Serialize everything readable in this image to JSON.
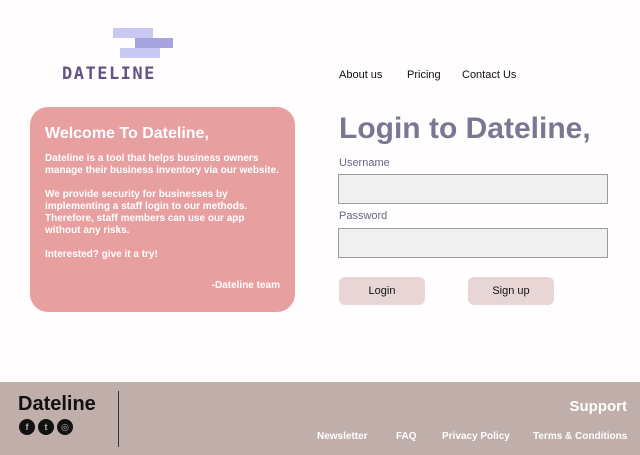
{
  "logo": {
    "text": "DATELINE"
  },
  "nav": {
    "about": "About us",
    "pricing": "Pricing",
    "contact": "Contact Us"
  },
  "welcome": {
    "title": "Welcome To Dateline,",
    "p1": "Dateline is a tool that helps business owners manage their business inventory via our website.",
    "p2": "We provide security for businesses by implementing a staff login to our methods. Therefore, staff members can use our app without any risks.",
    "p3": "Interested? give it a try!",
    "signature": "-Dateline team"
  },
  "login": {
    "title": "Login to Dateline,",
    "username_label": "Username",
    "username_value": "",
    "password_label": "Password",
    "password_value": "",
    "login_button": "Login",
    "signup_button": "Sign up"
  },
  "footer": {
    "brand": "Dateline",
    "support": "Support",
    "social": [
      {
        "icon": "facebook-icon",
        "glyph": "f"
      },
      {
        "icon": "twitter-icon",
        "glyph": "t"
      },
      {
        "icon": "instagram-icon",
        "glyph": "◎"
      }
    ],
    "links": [
      "Newsletter",
      "FAQ",
      "Privacy Policy",
      "Terms & Conditions"
    ]
  },
  "colors": {
    "card": "#e89fa0",
    "title": "#7a7793",
    "footer": "#c0aeab",
    "button": "#e8d6d7",
    "logo_text": "#5f5580"
  }
}
